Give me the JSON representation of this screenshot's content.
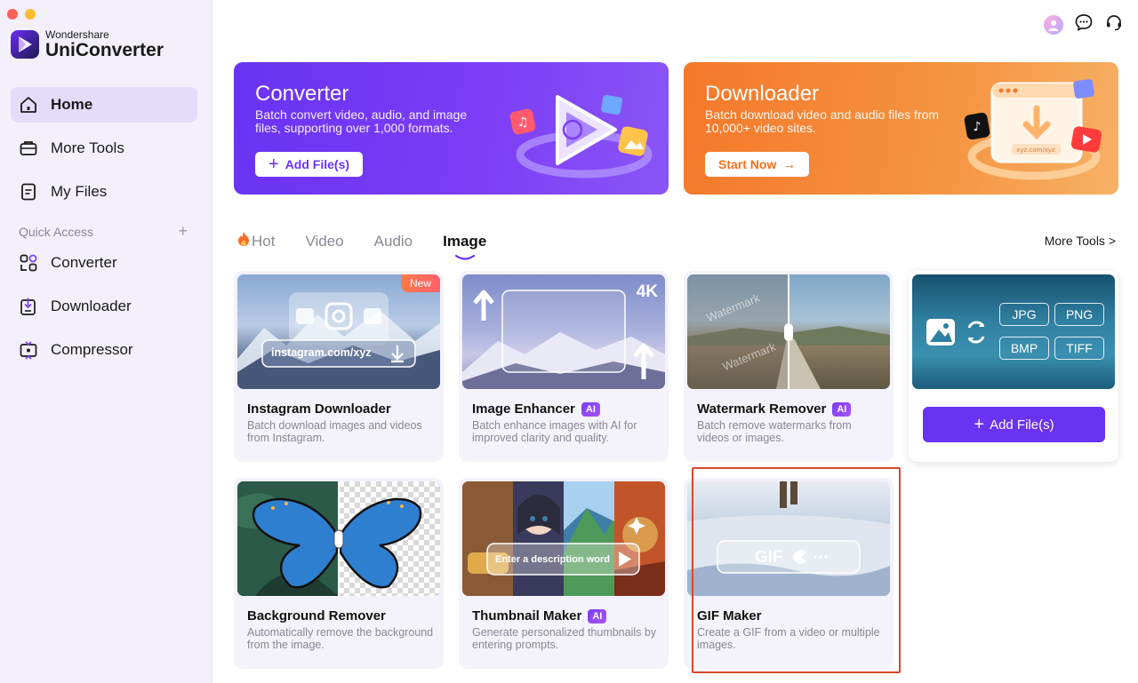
{
  "app": {
    "brand_small": "Wondershare",
    "brand_big": "UniConverter"
  },
  "sidebar": {
    "items": [
      {
        "label": "Home",
        "icon": "home-icon"
      },
      {
        "label": "More Tools",
        "icon": "toolbox-icon"
      },
      {
        "label": "My Files",
        "icon": "file-icon"
      }
    ],
    "quick_access_label": "Quick Access",
    "quick_access_add": "+",
    "quick_items": [
      {
        "label": "Converter",
        "icon": "converter-icon"
      },
      {
        "label": "Downloader",
        "icon": "downloader-icon"
      },
      {
        "label": "Compressor",
        "icon": "compressor-icon"
      }
    ]
  },
  "banners": {
    "converter": {
      "title": "Converter",
      "desc": "Batch convert video, audio, and image files, supporting over 1,000 formats.",
      "button": "Add File(s)"
    },
    "downloader": {
      "title": "Downloader",
      "desc": "Batch download video and audio files from 10,000+ video sites.",
      "button": "Start Now",
      "art_url": "xyz.com/xyz"
    }
  },
  "tabs": [
    {
      "label": "Hot",
      "icon": "fire-icon"
    },
    {
      "label": "Video"
    },
    {
      "label": "Audio"
    },
    {
      "label": "Image",
      "active": true
    }
  ],
  "more_tools": "More Tools >",
  "cards": [
    {
      "title": "Instagram Downloader",
      "desc": "Batch download images and videos from Instagram.",
      "badge": "New",
      "thumb_text": "instagram.com/xyz"
    },
    {
      "title": "Image Enhancer",
      "desc": "Batch enhance images with AI for improved clarity and quality.",
      "ai": "AI",
      "thumb_text": "4K"
    },
    {
      "title": "Watermark Remover",
      "desc": "Batch remove watermarks from videos or images.",
      "ai": "AI",
      "thumb_text": "Watermark"
    },
    {
      "title": "Background Remover",
      "desc": "Automatically remove the background from the image."
    },
    {
      "title": "Thumbnail Maker",
      "desc": "Generate personalized thumbnails by entering prompts.",
      "ai": "AI",
      "thumb_text": "Enter a description word"
    },
    {
      "title": "GIF Maker",
      "desc": "Create a GIF from a video or multiple images.",
      "thumb_text": "GIF"
    }
  ],
  "image_converter": {
    "formats": [
      "JPG",
      "PNG",
      "BMP",
      "TIFF"
    ],
    "button": "Add File(s)"
  },
  "colors": {
    "accent": "#6a32f3",
    "orange": "#f4782a",
    "highlight": "#d9452e"
  }
}
